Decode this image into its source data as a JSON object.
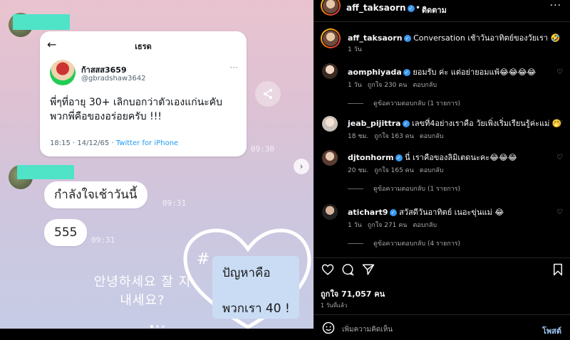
{
  "media": {
    "tweet": {
      "header_title": "เธรด",
      "back_icon": "arrow-left-icon",
      "name": "ก้าสสส3659",
      "handle": "@gbradshaw3642",
      "more": "···",
      "text": "พี่ๆที่อายุ 30+ เลิกบอกว่าตัวเองแก่นะคับ พวกพี่คือของอร่อยครับ !!!",
      "time": "18:15 · 14/12/65 · ",
      "source": "Twitter for iPhone"
    },
    "chat": {
      "ts1": "09:30",
      "bubble1": "กำลังใจเช้าวันนี้",
      "ts2": "09:31",
      "bubble2": "555",
      "ts3": "09:31"
    },
    "korean_text": "안녕하세요 잘 지내세요?",
    "hash": "#",
    "note_line1": "ปัญหาคือ",
    "note_line2": "พวกเรา 40 !",
    "carousel": {
      "count": 3,
      "active": 0
    }
  },
  "panel": {
    "header": {
      "username": "aff_taksaorn",
      "dot": "•",
      "follow_label": "ติดตาม",
      "more": "···"
    },
    "caption": {
      "username": "aff_taksaorn",
      "text": "Conversation เช้าวันอาทิตย์ของวัยเรา 🤣",
      "time": "1 วัน"
    },
    "comments": [
      {
        "username": "aomphiyada",
        "verified": true,
        "text": "ยอมรับ ค่ะ แต่อย่ายอมแพ้😂😂😂😂",
        "time": "1 วัน",
        "likes": "ถูกใจ 230 คน",
        "reply": "ตอบกลับ",
        "replies": "ดูข้อความตอบกลับ (1 รายการ)"
      },
      {
        "username": "jeab_pijittra",
        "verified": true,
        "text": "เลขที่4อย่างเราคือ วัยเพิ่งเริ่มเรียนรู้ค่ะแม่ 🤭",
        "time": "18 ชม.",
        "likes": "ถูกใจ 163 คน",
        "reply": "ตอบกลับ",
        "replies": ""
      },
      {
        "username": "djtonhorm",
        "verified": true,
        "text": "นี่ เราคือของลิมิเตดนะคะ😂😂😂",
        "time": "20 ชม.",
        "likes": "ถูกใจ 165 คน",
        "reply": "ตอบกลับ",
        "replies": "ดูข้อความตอบกลับ (1 รายการ)"
      },
      {
        "username": "atichart9",
        "verified": true,
        "text": "สวัสดีวันอาทิตย์ เนอะขุ่นแม่ 😂",
        "time": "1 วัน",
        "likes": "ถูกใจ 271 คน",
        "reply": "ตอบกลับ",
        "replies": "ดูข้อความตอบกลับ (4 รายการ)"
      }
    ],
    "actions": {
      "like_icon": "heart-outline-icon",
      "comment_icon": "comment-bubble-icon",
      "share_icon": "paper-plane-icon",
      "save_icon": "bookmark-icon"
    },
    "likes_text": "ถูกใจ 71,057 คน",
    "posted_ago": "1 วันที่แล้ว",
    "comment_input": {
      "placeholder": "เพิ่มความคิดเห็น",
      "post_label": "โพสต์"
    },
    "colors": {
      "verified": "#3897f0",
      "post": "#a0c7f7",
      "background": "#000000"
    }
  }
}
